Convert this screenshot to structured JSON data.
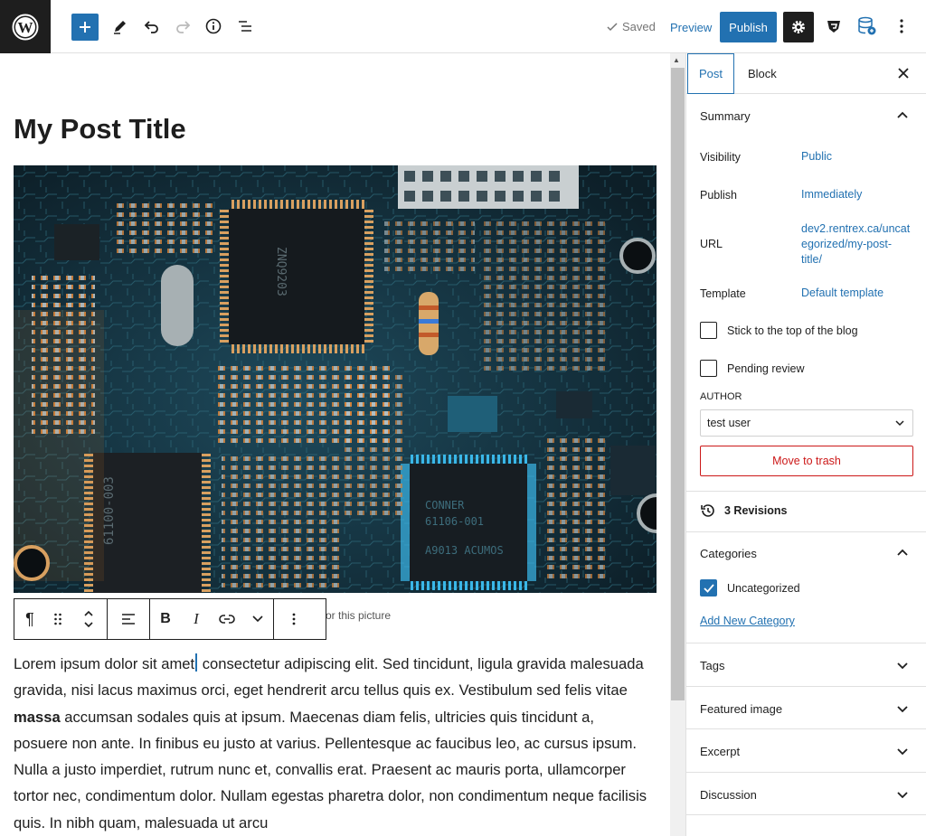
{
  "topbar": {
    "saved_label": "Saved",
    "preview_label": "Preview",
    "publish_label": "Publish",
    "icons": [
      "wordpress-icon",
      "plus-icon",
      "pencil-icon",
      "undo-icon",
      "redo-icon",
      "info-icon",
      "list-view-icon",
      "gear-icon",
      "shield-icon",
      "database-icon",
      "more-vertical-icon"
    ]
  },
  "editor": {
    "post_title": "My Post Title",
    "image_caption_partial": "or this picture",
    "paragraph_before_caret": "Lorem ipsum dolor sit amet",
    "paragraph_after_caret": " consectetur adipiscing elit. Sed tincidunt, ligula gravida malesuada gravida, nisi lacus maximus orci, eget hendrerit arcu tellus quis ex. Vestibulum sed felis vitae ",
    "paragraph_bold": "massa",
    "paragraph_tail": " accumsan sodales quis at ipsum. Maecenas diam felis, ultricies quis tincidunt a, posuere non ante. In finibus eu justo at varius. Pellentesque ac faucibus leo, ac cursus ipsum. Nulla a justo imperdiet, rutrum nunc et, convallis erat. Praesent ac mauris porta, ullamcorper tortor nec, condimentum dolor. Nullam egestas pharetra dolor, non condimentum neque facilisis quis. In nibh quam, malesuada ut arcu",
    "block_toolbar": {
      "paragraph_icon": "¶",
      "bold_label": "B",
      "italic_label": "I"
    }
  },
  "sidebar": {
    "tab_post": "Post",
    "tab_block": "Block",
    "summary_title": "Summary",
    "visibility_label": "Visibility",
    "visibility_value": "Public",
    "publish_label": "Publish",
    "publish_value": "Immediately",
    "url_label": "URL",
    "url_line1": "dev2.rentrex.ca/uncat",
    "url_line2": "egorized/my-post-",
    "url_line3": "title/",
    "template_label": "Template",
    "template_value": "Default template",
    "stick_label": "Stick to the top of the blog",
    "pending_label": "Pending review",
    "author_label": "AUTHOR",
    "author_value": "test user",
    "trash_label": "Move to trash",
    "revisions_label": "3 Revisions",
    "categories_title": "Categories",
    "category_uncategorized": "Uncategorized",
    "add_category": "Add New Category",
    "tags_title": "Tags",
    "featured_title": "Featured image",
    "excerpt_title": "Excerpt",
    "discussion_title": "Discussion"
  },
  "colors": {
    "accent": "#2271b1",
    "dark": "#1e1e1e",
    "danger": "#cc1818"
  }
}
